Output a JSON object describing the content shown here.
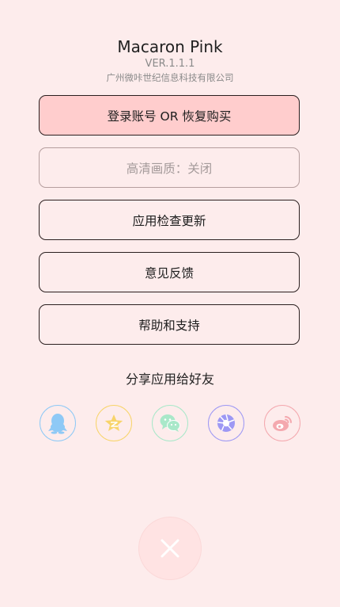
{
  "app": {
    "title": "Macaron Pink",
    "version": "VER.1.1.1",
    "company": "广州微咔世纪信息科技有限公司"
  },
  "menu": {
    "login": "登录账号 OR 恢复购买",
    "hd_quality": "高清画质：关闭",
    "check_update": "应用检查更新",
    "feedback": "意见反馈",
    "help": "帮助和支持"
  },
  "share": {
    "title": "分享应用给好友",
    "targets": [
      {
        "name": "qq-icon",
        "color": "#8ec9f6"
      },
      {
        "name": "qzone-star-icon",
        "color": "#f8d46a"
      },
      {
        "name": "wechat-icon",
        "color": "#a9e8c9"
      },
      {
        "name": "moments-aperture-icon",
        "color": "#9d98f4"
      },
      {
        "name": "weibo-icon",
        "color": "#f4a8ae"
      }
    ]
  },
  "colors": {
    "background": "#fdecec",
    "primary_button": "#ffcdcd",
    "close_icon": "#ffffff"
  },
  "icons": {
    "close": "close-icon"
  }
}
